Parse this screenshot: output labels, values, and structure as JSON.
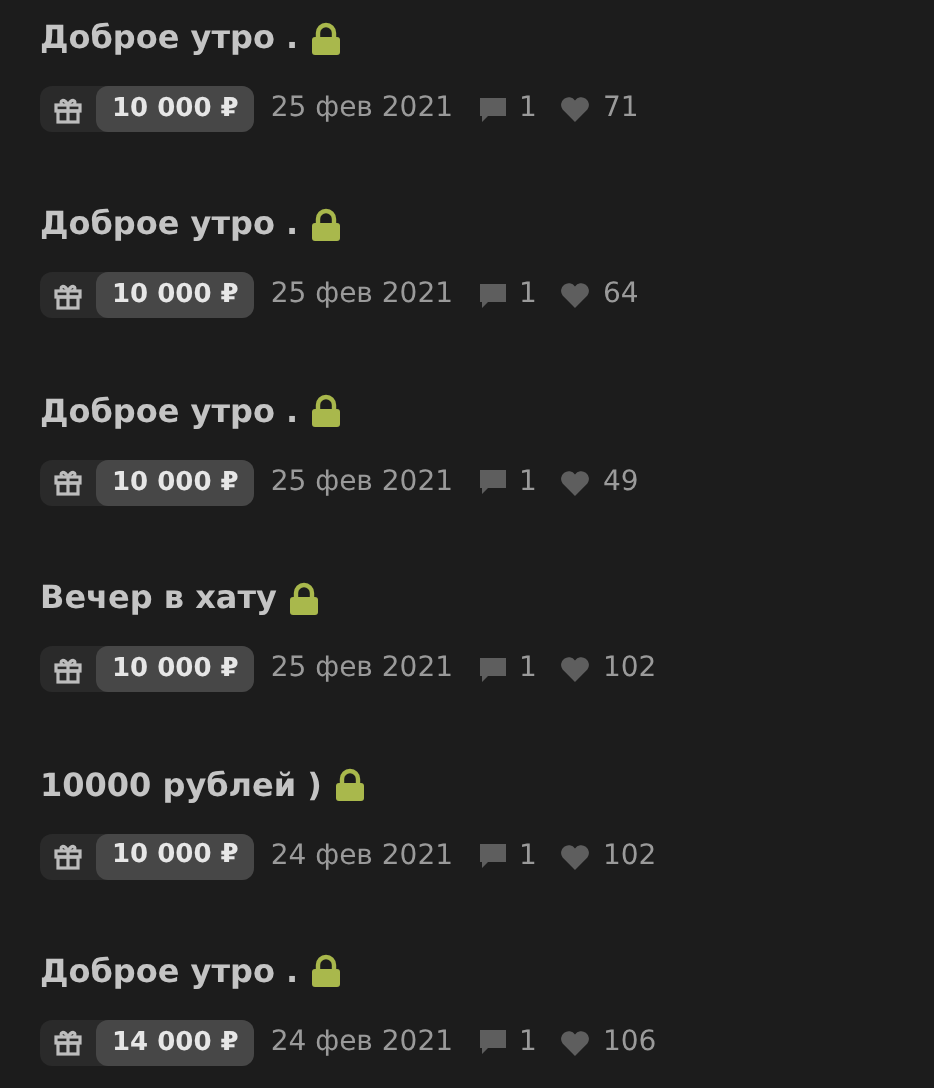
{
  "posts": [
    {
      "title": "Доброе утро .",
      "locked": true,
      "price": "10 000 ₽",
      "date": "25 фев 2021",
      "comments": "1",
      "likes": "71"
    },
    {
      "title": "Доброе утро .",
      "locked": true,
      "price": "10 000 ₽",
      "date": "25 фев 2021",
      "comments": "1",
      "likes": "64"
    },
    {
      "title": "Доброе утро .",
      "locked": true,
      "price": "10 000 ₽",
      "date": "25 фев 2021",
      "comments": "1",
      "likes": "49"
    },
    {
      "title": "Вечер в хату",
      "locked": true,
      "price": "10 000 ₽",
      "date": "25 фев 2021",
      "comments": "1",
      "likes": "102"
    },
    {
      "title": "10000 рублей )",
      "locked": true,
      "price": "10 000 ₽",
      "date": "24 фев 2021",
      "comments": "1",
      "likes": "102"
    },
    {
      "title": "Доброе утро .",
      "locked": true,
      "price": "14 000 ₽",
      "date": "24 фев 2021",
      "comments": "1",
      "likes": "106"
    }
  ]
}
